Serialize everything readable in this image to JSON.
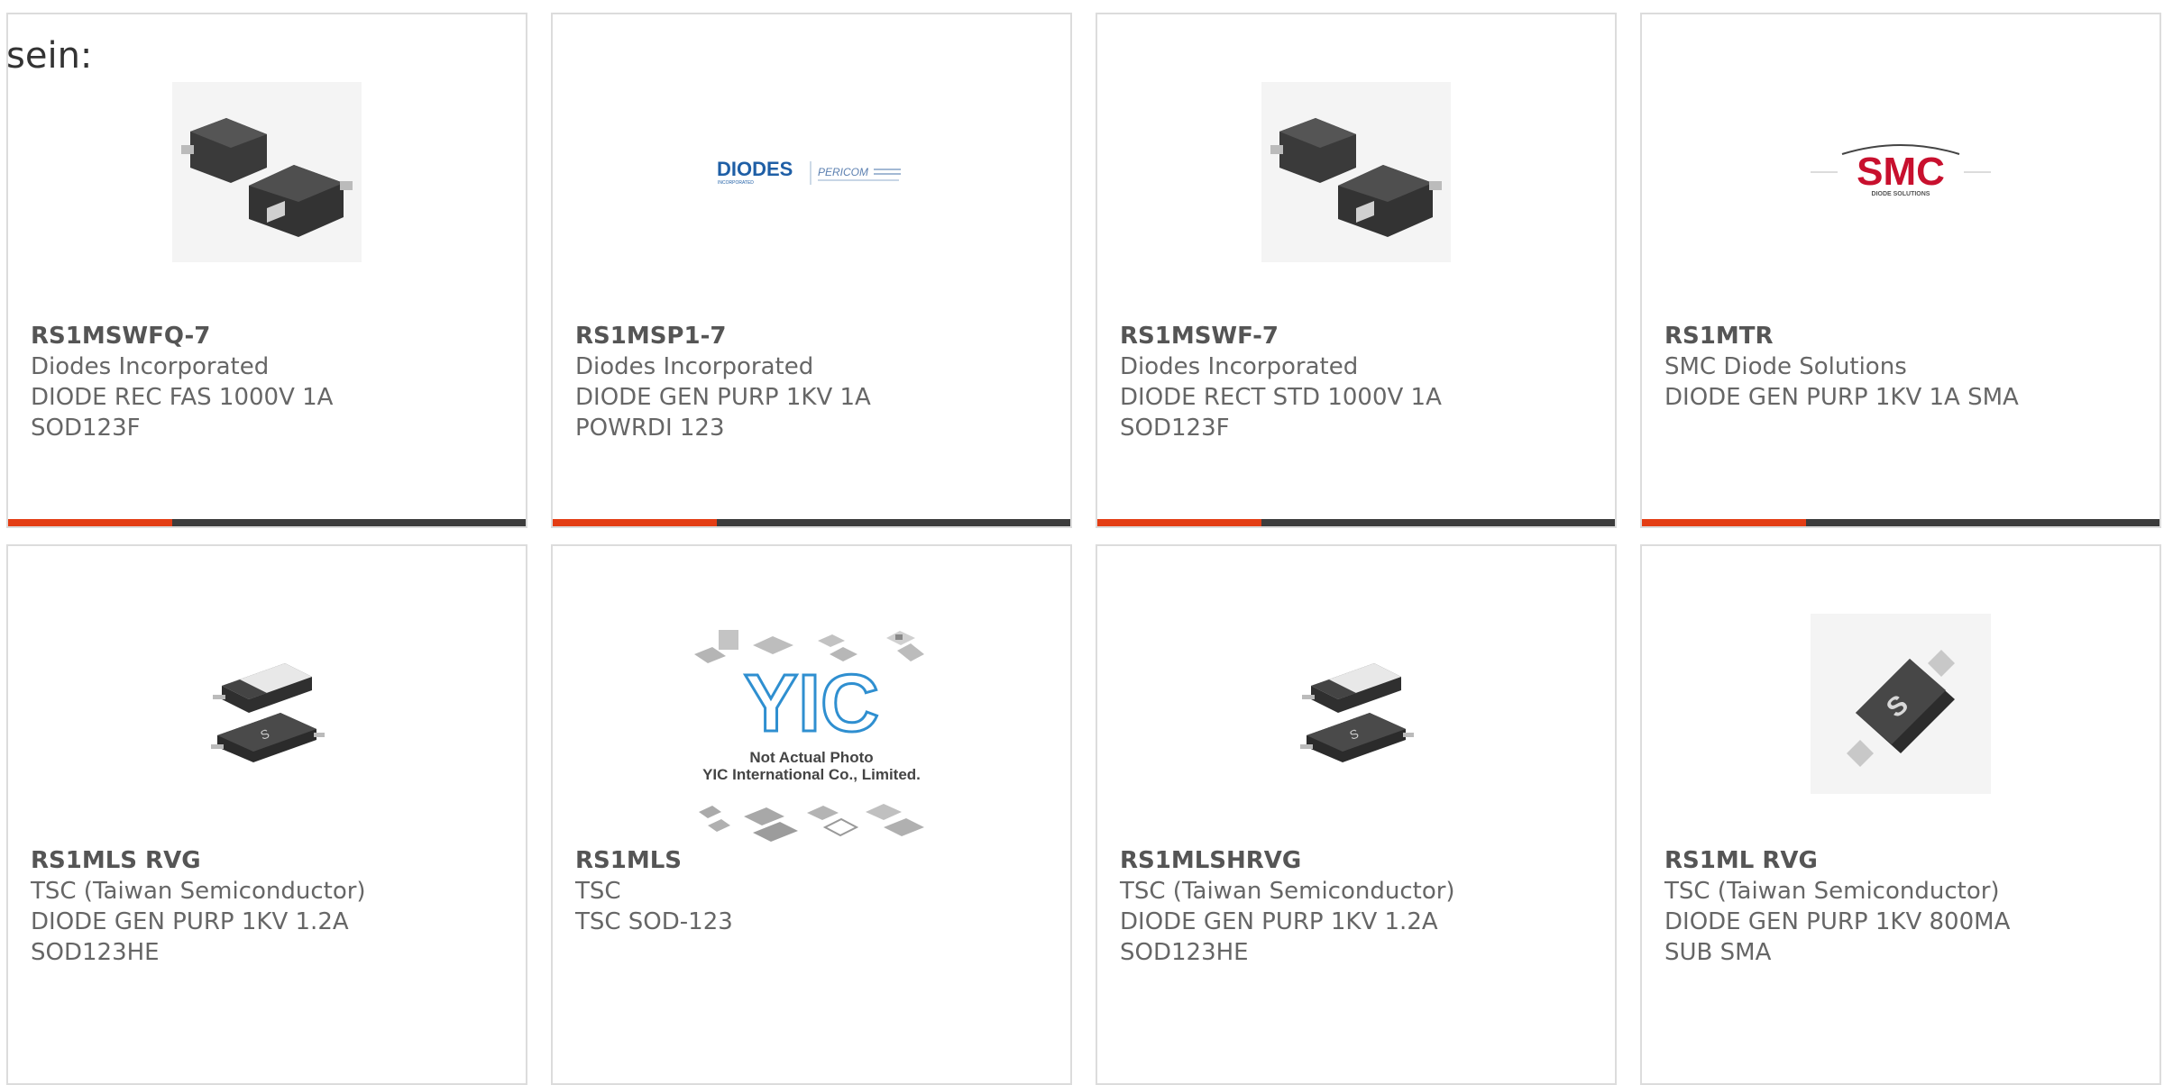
{
  "intro_text": "sein:",
  "products": [
    {
      "part_number": "RS1MSWFQ-7",
      "manufacturer": "Diodes Incorporated",
      "desc1": "DIODE REC FAS 1000V 1A",
      "desc2": "SOD123F",
      "image": "sod123f-package-icon"
    },
    {
      "part_number": "RS1MSP1-7",
      "manufacturer": "Diodes Incorporated",
      "desc1": "DIODE GEN PURP 1KV 1A",
      "desc2": "POWRDI 123",
      "image": "diodes-pericom-logo",
      "logo_text": "DIODES",
      "logo_sub": "INCORPORATED",
      "logo_text2": "PERICOM"
    },
    {
      "part_number": "RS1MSWF-7",
      "manufacturer": "Diodes Incorporated",
      "desc1": "DIODE RECT STD 1000V 1A",
      "desc2": "SOD123F",
      "image": "sod123f-package-icon"
    },
    {
      "part_number": "RS1MTR",
      "manufacturer": "SMC Diode Solutions",
      "desc1": "DIODE GEN PURP 1KV 1A SMA",
      "desc2": "",
      "image": "smc-logo",
      "logo_text": "SMC",
      "logo_sub": "DIODE SOLUTIONS"
    },
    {
      "part_number": "RS1MLS RVG",
      "manufacturer": "TSC (Taiwan Semiconductor)",
      "desc1": "DIODE GEN PURP 1KV 1.2A",
      "desc2": "SOD123HE",
      "image": "sod123he-package-icon"
    },
    {
      "part_number": "RS1MLS",
      "manufacturer": "TSC",
      "desc1": "TSC SOD-123",
      "desc2": "",
      "image": "yic-not-actual-photo",
      "logo_text": "YIC",
      "caption1": "Not Actual Photo",
      "caption2": "YIC International Co., Limited."
    },
    {
      "part_number": "RS1MLSHRVG",
      "manufacturer": "TSC (Taiwan Semiconductor)",
      "desc1": "DIODE GEN PURP 1KV 1.2A",
      "desc2": "SOD123HE",
      "image": "sod123he-package-icon"
    },
    {
      "part_number": "RS1ML RVG",
      "manufacturer": "TSC (Taiwan Semiconductor)",
      "desc1": "DIODE GEN PURP 1KV 800MA",
      "desc2": "SUB SMA",
      "image": "sub-sma-package-icon"
    }
  ],
  "colors": {
    "accent": "#e33d14",
    "bar": "#3c3c3c",
    "border": "#dcdcdc",
    "text": "#666666"
  }
}
